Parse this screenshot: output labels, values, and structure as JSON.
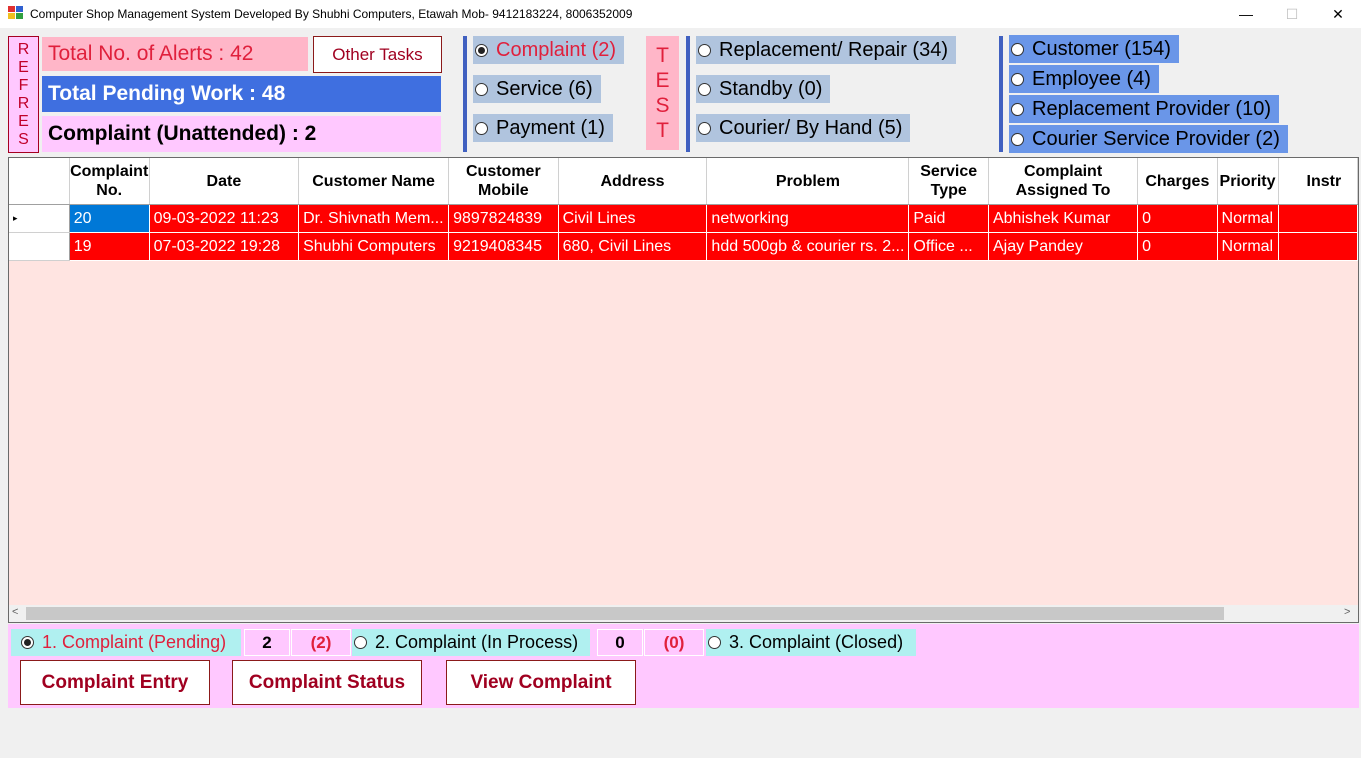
{
  "window": {
    "title": "Computer Shop Management System Developed By Shubhi Computers, Etawah Mob- 9412183224, 8006352009",
    "minimize": "—",
    "maximize": "☐",
    "close": "✕"
  },
  "summary": {
    "refresh_letters": [
      "R",
      "E",
      "F",
      "R",
      "E",
      "S"
    ],
    "alerts": "Total No. of Alerts : 42",
    "other_tasks": "Other Tasks",
    "pending": "Total Pending Work : 48",
    "unattended": "Complaint (Unattended) : 2"
  },
  "filters": {
    "group1": [
      {
        "label": "Complaint (2)",
        "selected": true
      },
      {
        "label": "Service (6)",
        "selected": false
      },
      {
        "label": "Payment (1)",
        "selected": false
      }
    ],
    "test_letters": [
      "T",
      "E",
      "S",
      "T"
    ],
    "group2": [
      {
        "label": "Replacement/ Repair (34)",
        "selected": false
      },
      {
        "label": "Standby (0)",
        "selected": false
      },
      {
        "label": "Courier/ By Hand (5)",
        "selected": false
      }
    ],
    "group3": [
      {
        "label": "Customer (154)",
        "selected": false
      },
      {
        "label": "Employee (4)",
        "selected": false
      },
      {
        "label": "Replacement Provider (10)",
        "selected": false
      },
      {
        "label": "Courier Service Provider (2)",
        "selected": false
      }
    ]
  },
  "grid": {
    "columns": [
      {
        "key": "no",
        "label": "Complaint No."
      },
      {
        "key": "date",
        "label": "Date"
      },
      {
        "key": "name",
        "label": "Customer Name"
      },
      {
        "key": "mobile",
        "label": "Customer Mobile"
      },
      {
        "key": "address",
        "label": "Address"
      },
      {
        "key": "problem",
        "label": "Problem"
      },
      {
        "key": "service",
        "label": "Service Type"
      },
      {
        "key": "assigned",
        "label": "Complaint Assigned To"
      },
      {
        "key": "charges",
        "label": "Charges"
      },
      {
        "key": "priority",
        "label": "Priority"
      },
      {
        "key": "instr",
        "label": "Instr"
      }
    ],
    "rows": [
      {
        "no": "20",
        "date": "09-03-2022 11:23",
        "name": "Dr. Shivnath Mem...",
        "mobile": "9897824839",
        "address": "Civil Lines",
        "problem": "networking",
        "service": "Paid",
        "assigned": "Abhishek Kumar",
        "charges": "0",
        "priority": "Normal",
        "instr": ""
      },
      {
        "no": "19",
        "date": "07-03-2022 19:28",
        "name": "Shubhi Computers",
        "mobile": "9219408345",
        "address": "680, Civil Lines",
        "problem": "hdd 500gb & courier rs. 2...",
        "service": "Office ...",
        "assigned": "Ajay Pandey",
        "charges": "0",
        "priority": "Normal",
        "instr": ""
      }
    ],
    "current_row_marker": "▸"
  },
  "status": {
    "pending_label": "1. Complaint (Pending)",
    "pending_count": "2",
    "pending_paren": "(2)",
    "in_process_label": "2. Complaint (In Process)",
    "in_process_count": "0",
    "in_process_paren": "(0)",
    "closed_label": "3. Complaint (Closed)",
    "selected": "pending"
  },
  "actions": {
    "entry": "Complaint Entry",
    "status": "Complaint Status",
    "view": "View Complaint"
  },
  "colors": {
    "row_red": "#ff0000",
    "selected_cell": "#0078d7",
    "grid_bg": "#ffe4e1",
    "pink_panel": "#ffc8ff",
    "blue_label": "#3f6fe0"
  }
}
